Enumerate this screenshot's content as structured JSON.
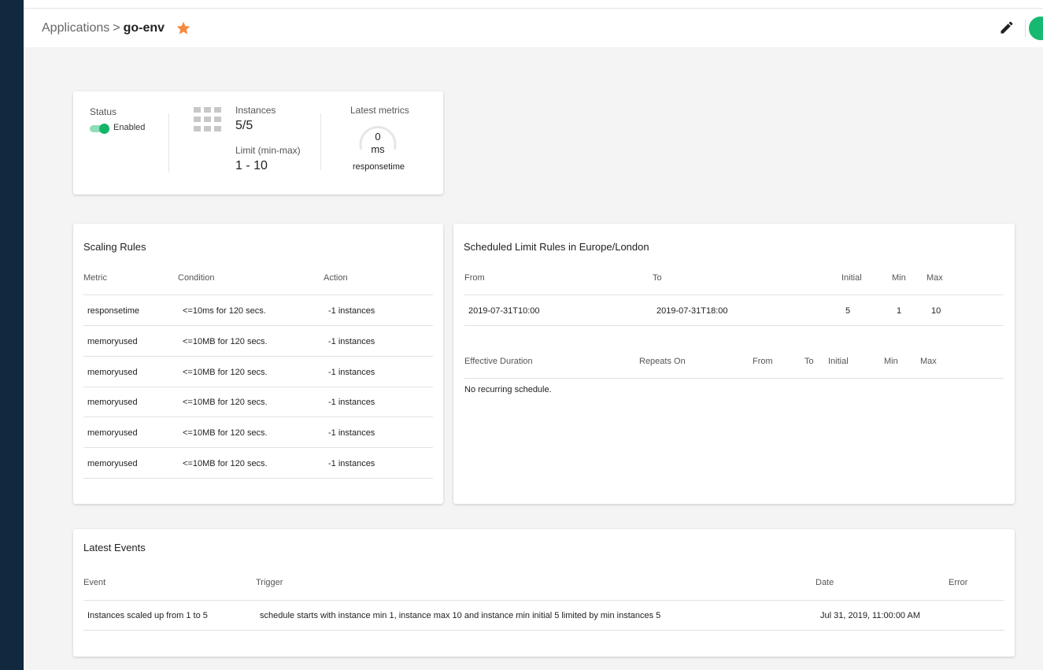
{
  "header": {
    "breadcrumb_root": "Applications",
    "breadcrumb_sep": ">",
    "breadcrumb_current": "go-env",
    "star_color": "#f5893d",
    "edit_icon": "pencil-icon"
  },
  "summary": {
    "status_label": "Status",
    "status_value": "Enabled",
    "instances_label": "Instances",
    "instances_value": "5/5",
    "limit_label": "Limit (min-max)",
    "limit_value": "1 - 10",
    "metrics_label": "Latest metrics",
    "metric_value": "0",
    "metric_unit": "ms",
    "metric_name": "responsetime"
  },
  "scaling_rules": {
    "title": "Scaling Rules",
    "headers": [
      "Metric",
      "Condition",
      "Action"
    ],
    "rows": [
      [
        "responsetime",
        "<=10ms for 120 secs.",
        "-1 instances"
      ],
      [
        "memoryused",
        "<=10MB for 120 secs.",
        "-1 instances"
      ],
      [
        "memoryused",
        "<=10MB for 120 secs.",
        "-1 instances"
      ],
      [
        "memoryused",
        "<=10MB for 120 secs.",
        "-1 instances"
      ],
      [
        "memoryused",
        "<=10MB for 120 secs.",
        "-1 instances"
      ],
      [
        "memoryused",
        "<=10MB for 120 secs.",
        "-1 instances"
      ]
    ]
  },
  "schedule": {
    "title": "Scheduled Limit Rules in Europe/London",
    "specific_headers": [
      "From",
      "To",
      "Initial",
      "Min",
      "Max"
    ],
    "specific_rows": [
      [
        "2019-07-31T10:00",
        "2019-07-31T18:00",
        "5",
        "1",
        "10"
      ]
    ],
    "recurring_headers": [
      "Effective Duration",
      "Repeats On",
      "From",
      "To",
      "Initial",
      "Min",
      "Max"
    ],
    "recurring_empty": "No recurring schedule."
  },
  "events": {
    "title": "Latest Events",
    "headers": [
      "Event",
      "Trigger",
      "Date",
      "Error"
    ],
    "rows": [
      [
        "Instances scaled up from 1 to 5",
        "schedule starts with instance min 1, instance max 10 and instance min initial 5 limited by min instances 5",
        "Jul 31, 2019, 11:00:00 AM",
        ""
      ]
    ]
  }
}
